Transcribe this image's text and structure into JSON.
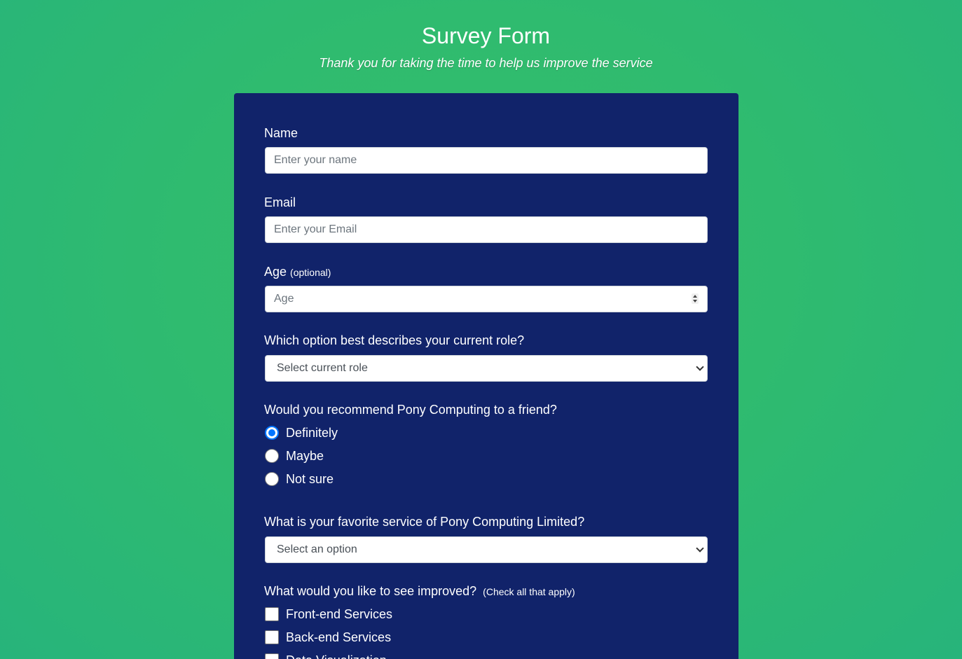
{
  "header": {
    "title": "Survey Form",
    "subtitle": "Thank you for taking the time to help us improve the service"
  },
  "form": {
    "name": {
      "label": "Name",
      "placeholder": "Enter your name"
    },
    "email": {
      "label": "Email",
      "placeholder": "Enter your Email"
    },
    "age": {
      "label": "Age",
      "hint": "(optional)",
      "placeholder": "Age"
    },
    "role": {
      "label": "Which option best describes your current role?",
      "selected": "Select current role"
    },
    "recommend": {
      "label": "Would you recommend Pony Computing to a friend?",
      "options": [
        "Definitely",
        "Maybe",
        "Not sure"
      ],
      "selected": "Definitely"
    },
    "favorite": {
      "label": "What is your favorite service of Pony Computing Limited?",
      "selected": "Select an option"
    },
    "improve": {
      "label": "What would you like to see improved?",
      "hint": "(Check all that apply)",
      "options": [
        "Front-end Services",
        "Back-end Services",
        "Data Visualization"
      ]
    }
  },
  "colors": {
    "background": "#2fbb6f",
    "card": "#11236a",
    "radio_checked": "#0075ff"
  }
}
